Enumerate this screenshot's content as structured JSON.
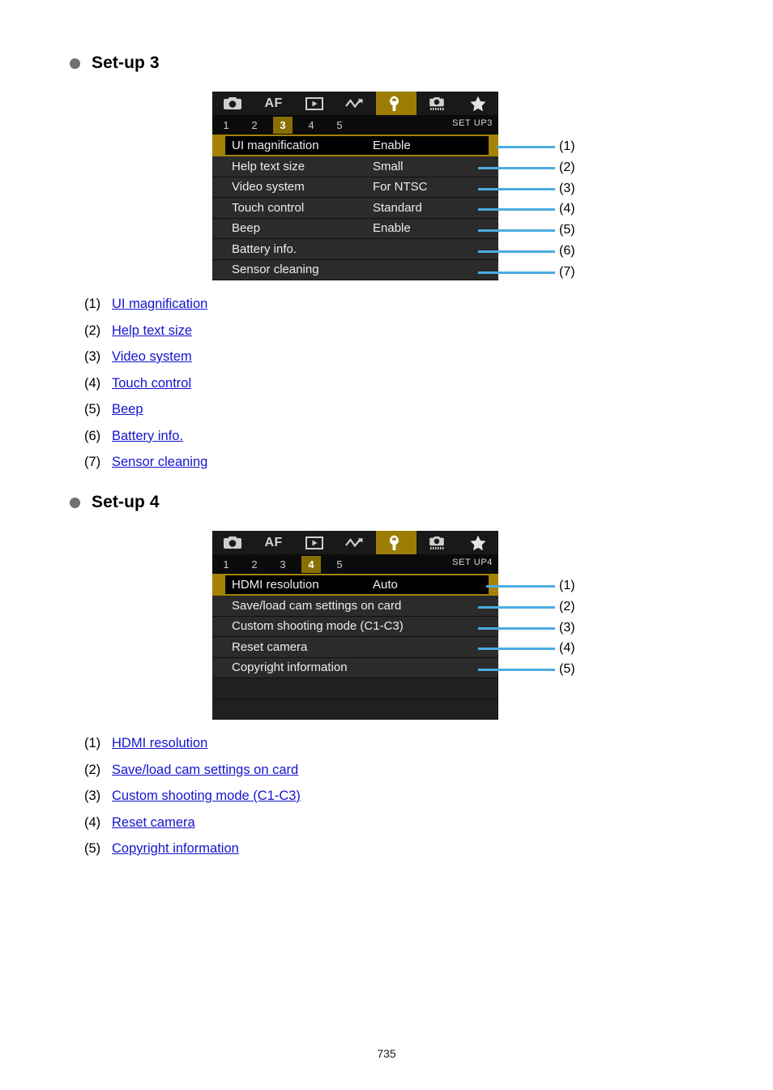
{
  "page": {
    "number": "735"
  },
  "sections": [
    {
      "heading": "Set-up 3",
      "screen": {
        "tabs": [
          {
            "icon": "camera-icon",
            "label": ""
          },
          {
            "icon": "af-text-icon",
            "label": "AF"
          },
          {
            "icon": "playback-icon",
            "label": ""
          },
          {
            "icon": "wireless-icon",
            "label": ""
          },
          {
            "icon": "wrench-icon",
            "label": "",
            "active": true
          },
          {
            "icon": "custom-func-camera-icon",
            "label": ""
          },
          {
            "icon": "star-icon",
            "label": ""
          }
        ],
        "page_numbers": [
          "1",
          "2",
          "3",
          "4",
          "5"
        ],
        "active_page": "3",
        "set_label": "SET UP3",
        "rows": [
          {
            "label": "UI magnification",
            "value": "Enable",
            "selected": true
          },
          {
            "label": "Help text size",
            "value": "Small",
            "selected": false
          },
          {
            "label": "Video system",
            "value": "For NTSC",
            "selected": false
          },
          {
            "label": "Touch control",
            "value": "Standard",
            "selected": false
          },
          {
            "label": "Beep",
            "value": "Enable",
            "selected": false
          },
          {
            "label": "Battery info.",
            "value": "",
            "selected": false
          },
          {
            "label": "Sensor cleaning",
            "value": "",
            "selected": false
          }
        ],
        "callouts": [
          "(1)",
          "(2)",
          "(3)",
          "(4)",
          "(5)",
          "(6)",
          "(7)"
        ]
      },
      "links": [
        {
          "index": "(1)",
          "label": "UI magnification"
        },
        {
          "index": "(2)",
          "label": "Help text size"
        },
        {
          "index": "(3)",
          "label": "Video system"
        },
        {
          "index": "(4)",
          "label": "Touch control"
        },
        {
          "index": "(5)",
          "label": "Beep"
        },
        {
          "index": "(6)",
          "label": "Battery info."
        },
        {
          "index": "(7)",
          "label": "Sensor cleaning"
        }
      ]
    },
    {
      "heading": "Set-up 4",
      "screen": {
        "tabs": [
          {
            "icon": "camera-icon",
            "label": ""
          },
          {
            "icon": "af-text-icon",
            "label": "AF"
          },
          {
            "icon": "playback-icon",
            "label": ""
          },
          {
            "icon": "wireless-icon",
            "label": ""
          },
          {
            "icon": "wrench-icon",
            "label": "",
            "active": true
          },
          {
            "icon": "custom-func-camera-icon",
            "label": ""
          },
          {
            "icon": "star-icon",
            "label": ""
          }
        ],
        "page_numbers": [
          "1",
          "2",
          "3",
          "4",
          "5"
        ],
        "active_page": "4",
        "set_label": "SET UP4",
        "rows": [
          {
            "label": "HDMI resolution",
            "value": "Auto",
            "selected": true
          },
          {
            "label": "Save/load cam settings on card",
            "value": "",
            "selected": false
          },
          {
            "label": "Custom shooting mode (C1-C3)",
            "value": "",
            "selected": false
          },
          {
            "label": "Reset camera",
            "value": "",
            "selected": false
          },
          {
            "label": "Copyright information",
            "value": "",
            "selected": false
          },
          {
            "label": "",
            "value": "",
            "selected": false,
            "blank": true
          },
          {
            "label": "",
            "value": "",
            "selected": false,
            "blank": true
          }
        ],
        "callouts": [
          "(1)",
          "(2)",
          "(3)",
          "(4)",
          "(5)"
        ]
      },
      "links": [
        {
          "index": "(1)",
          "label": "HDMI resolution"
        },
        {
          "index": "(2)",
          "label": "Save/load cam settings on card"
        },
        {
          "index": "(3)",
          "label": "Custom shooting mode (C1-C3)"
        },
        {
          "index": "(4)",
          "label": "Reset camera"
        },
        {
          "index": "(5)",
          "label": "Copyright information"
        }
      ]
    }
  ],
  "colors": {
    "accent_gold": "#a58206",
    "tab_active": "#9b7d06",
    "leader_blue": "#4aade0",
    "link_blue": "#1414cf",
    "bullet_gray": "#707070"
  }
}
